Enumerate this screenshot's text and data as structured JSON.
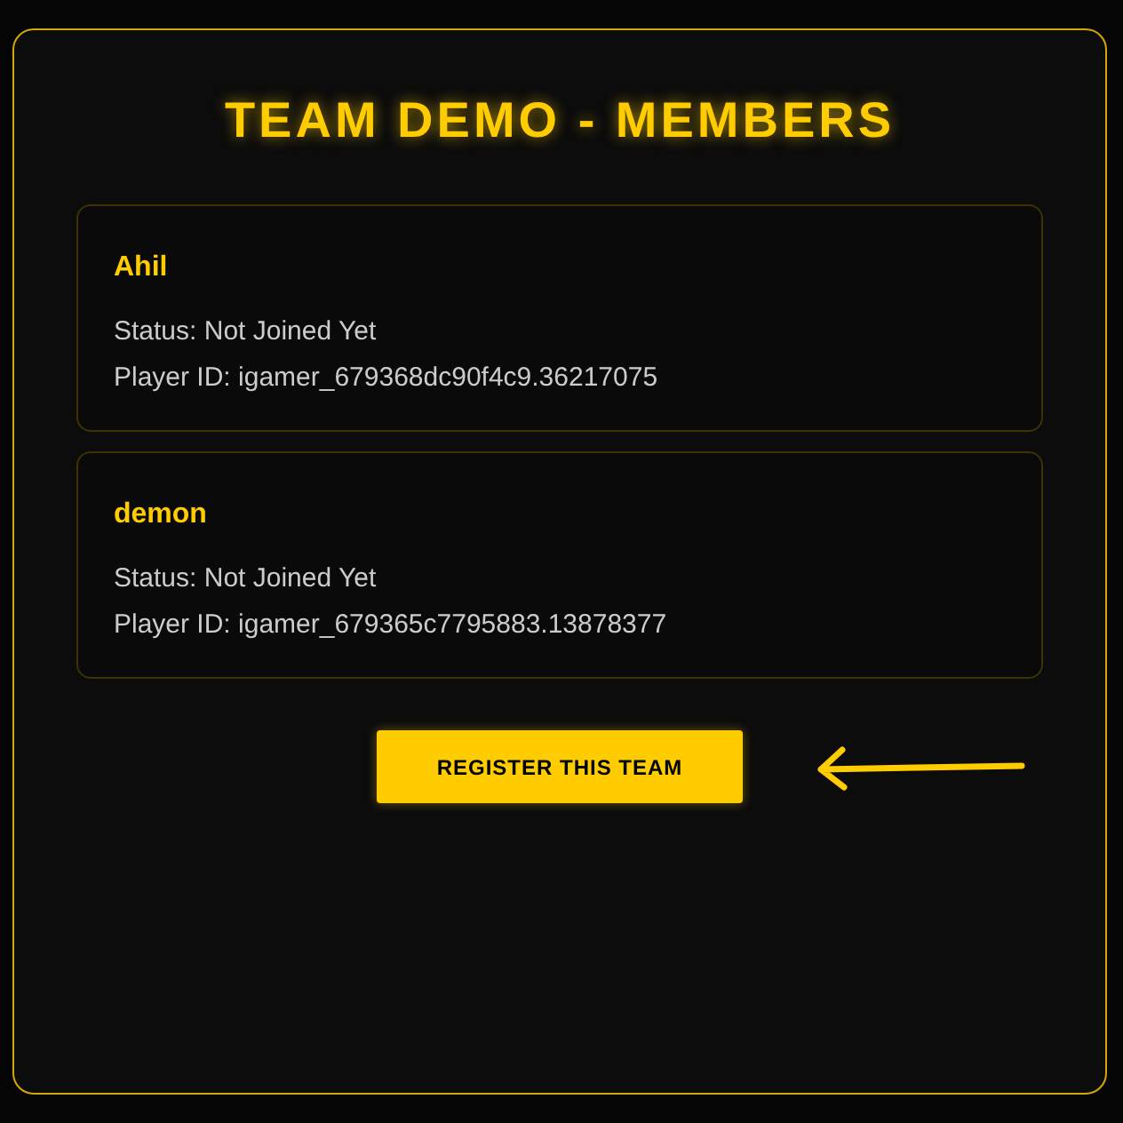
{
  "title": "TEAM DEMO - MEMBERS",
  "members": [
    {
      "name": "Ahil",
      "status": "Status: Not Joined Yet",
      "player_id": "Player ID: igamer_679368dc90f4c9.36217075"
    },
    {
      "name": "demon",
      "status": "Status: Not Joined Yet",
      "player_id": "Player ID: igamer_679365c7795883.13878377"
    }
  ],
  "button": "REGISTER THIS TEAM"
}
